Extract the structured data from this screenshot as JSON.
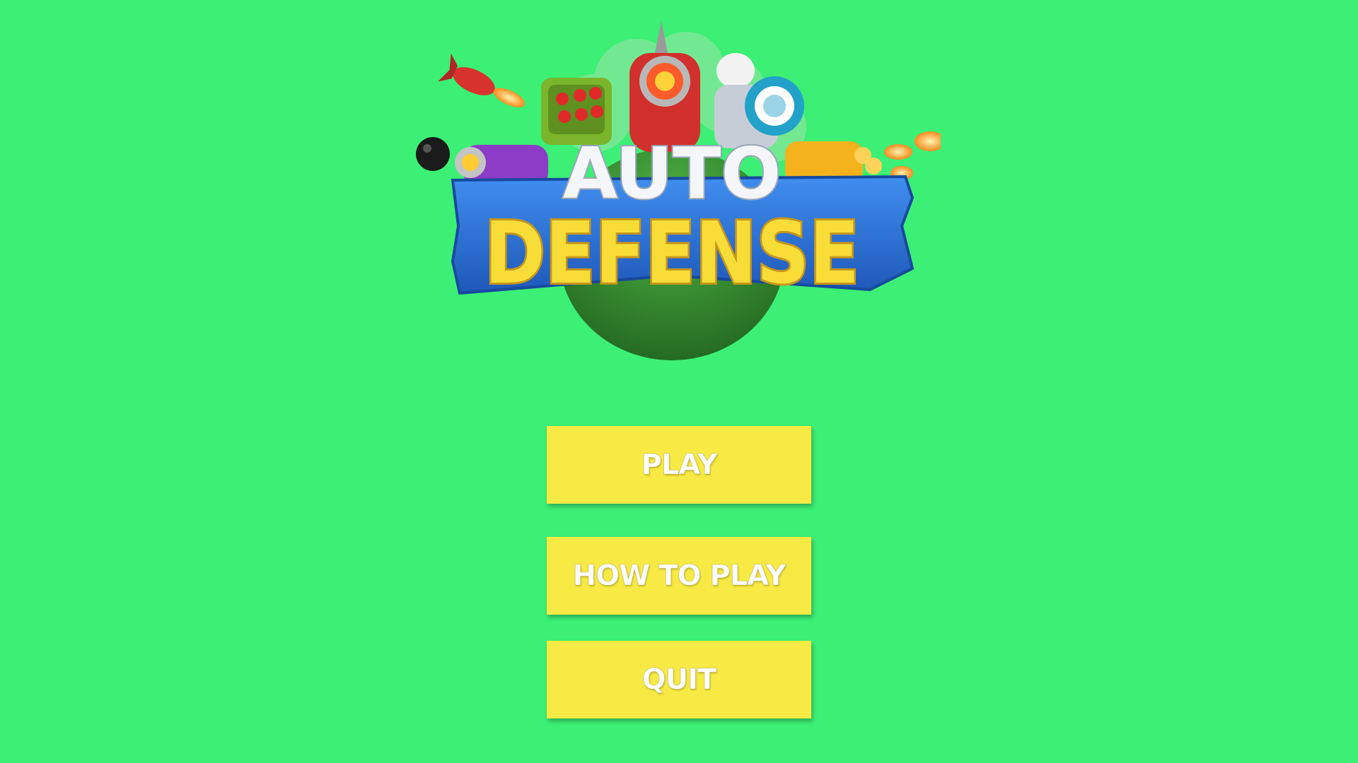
{
  "colors": {
    "background": "#3bf075",
    "button": "#f8ea44",
    "button_text": "#ffffff",
    "logo_text_top": "#f4f6fa",
    "logo_text_bottom": "#f8dd38",
    "logo_banner": "#2f74d6",
    "planet": "#2f8a2c"
  },
  "logo": {
    "line1": "AUTO",
    "line2": "DEFENSE"
  },
  "menu": {
    "play_label": "PLAY",
    "how_to_play_label": "HOW TO PLAY",
    "quit_label": "QUIT"
  }
}
